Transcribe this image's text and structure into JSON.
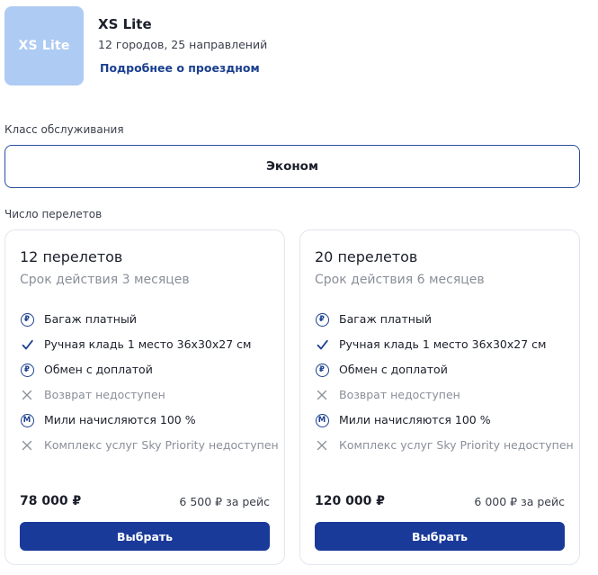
{
  "colors": {
    "accent": "#1a3a9a",
    "logo_bg": "#aecbf3",
    "muted": "#8a8f99"
  },
  "header": {
    "logo_text": "XS Lite",
    "title": "XS Lite",
    "subtitle": "12 городов, 25 направлений",
    "link": "Подробнее о проездном"
  },
  "service_class": {
    "label": "Класс обслуживания",
    "value": "Эконом"
  },
  "flights": {
    "label": "Число перелетов",
    "cards": [
      {
        "title": "12 перелетов",
        "validity": "Срок действия 3 месяцев",
        "features": [
          {
            "icon": "ruble-circle-icon",
            "text": "Багаж платный"
          },
          {
            "icon": "checkmark-icon",
            "text": "Ручная кладь 1 место 36x30x27 см"
          },
          {
            "icon": "ruble-circle-icon",
            "text": "Обмен с доплатой"
          },
          {
            "icon": "cross-icon",
            "text": "Возврат недоступен"
          },
          {
            "icon": "miles-circle-icon",
            "text": "Мили начисляются 100 %"
          },
          {
            "icon": "cross-icon",
            "text": "Комплекс услуг Sky Priority недоступен"
          }
        ],
        "price": "78 000 ₽",
        "per_flight": "6 500 ₽ за рейс",
        "button": "Выбрать"
      },
      {
        "title": "20 перелетов",
        "validity": "Срок действия 6 месяцев",
        "features": [
          {
            "icon": "ruble-circle-icon",
            "text": "Багаж платный"
          },
          {
            "icon": "checkmark-icon",
            "text": "Ручная кладь 1 место 36x30x27 см"
          },
          {
            "icon": "ruble-circle-icon",
            "text": "Обмен с доплатой"
          },
          {
            "icon": "cross-icon",
            "text": "Возврат недоступен"
          },
          {
            "icon": "miles-circle-icon",
            "text": "Мили начисляются 100 %"
          },
          {
            "icon": "cross-icon",
            "text": "Комплекс услуг Sky Priority недоступен"
          }
        ],
        "price": "120 000 ₽",
        "per_flight": "6 000 ₽ за рейс",
        "button": "Выбрать"
      }
    ]
  }
}
